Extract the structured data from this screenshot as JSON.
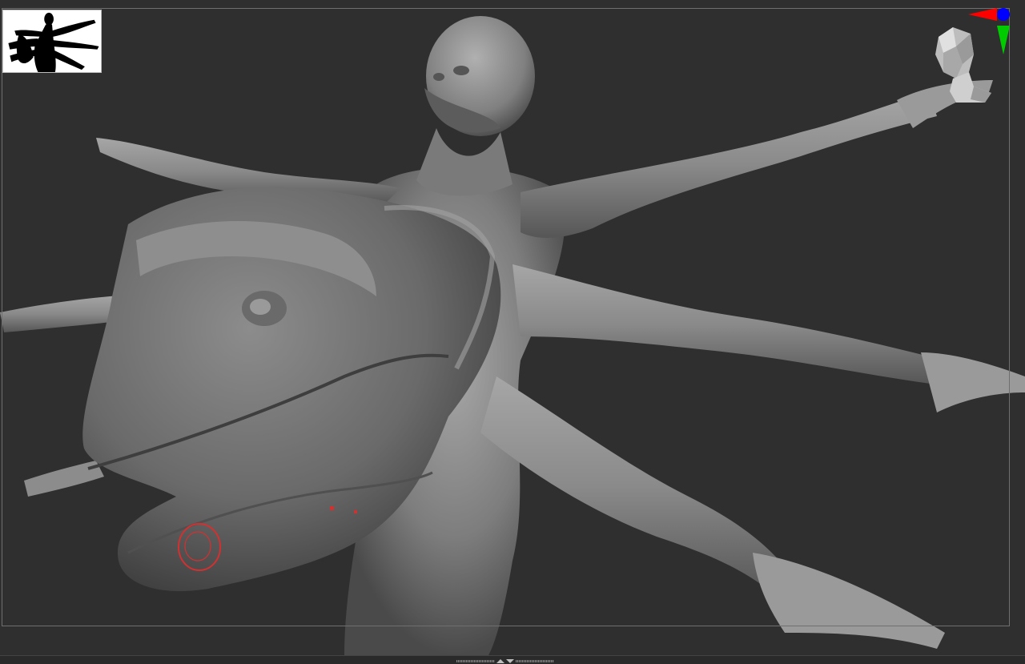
{
  "canvas": {
    "background_color": "#2f2f2f",
    "frame_color": "#6f6f6f",
    "model_color": "#8a8a8a"
  },
  "navigation": {
    "axis_colors": {
      "x": "#ff0000",
      "y": "#00cc00",
      "z": "#0000ff"
    },
    "gizmo_icon": "head-navigation-cube-icon"
  },
  "silhouette": {
    "icon": "silhouette-preview-icon",
    "background": "#ffffff",
    "fill": "#000000"
  },
  "brush": {
    "icon": "brush-cursor-icon",
    "color": "#d43030"
  },
  "bottom_bar": {
    "icons": [
      "grip-icon",
      "collapse-up-icon",
      "expand-down-icon",
      "grip-icon"
    ]
  }
}
